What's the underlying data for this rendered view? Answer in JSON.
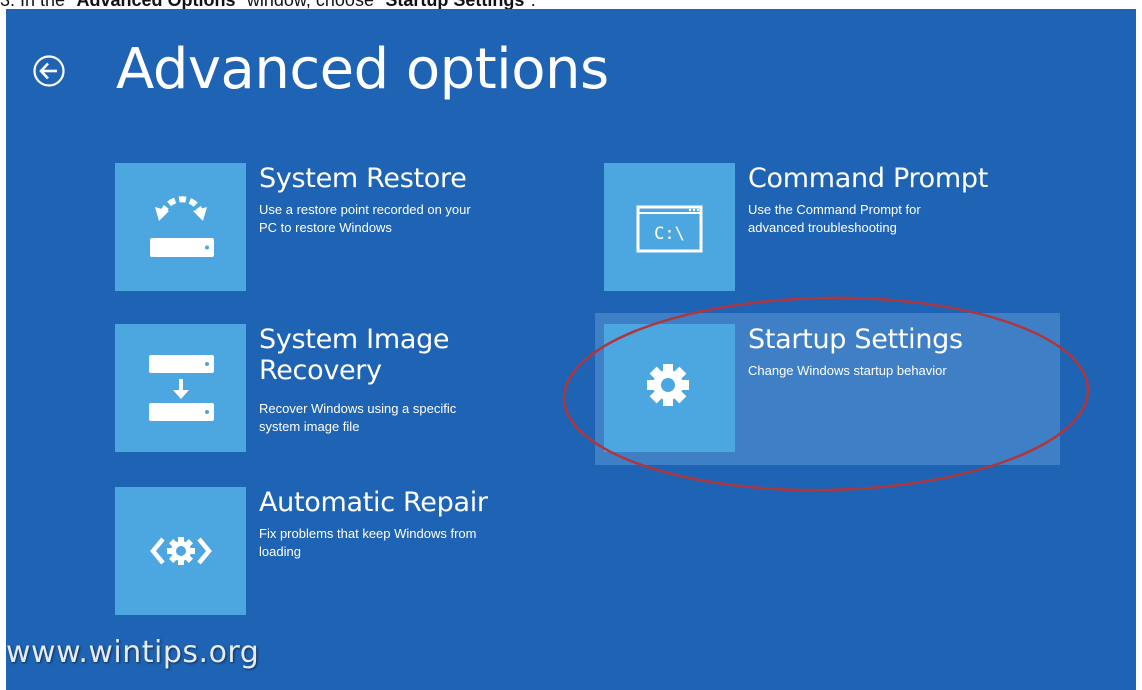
{
  "instruction": {
    "prefix": "3. In the \"",
    "window_name": "Advanced Options",
    "middle": "\" window, choose \"",
    "choice": "Startup Settings",
    "suffix": "\"."
  },
  "header": {
    "back_label": "Back",
    "title": "Advanced options"
  },
  "options": [
    {
      "name": "System Restore",
      "desc_lines": [
        "Use a restore point recorded on your",
        "PC to restore Windows"
      ],
      "icon": "system-restore-icon"
    },
    {
      "name_lines": [
        "System Image",
        "Recovery"
      ],
      "desc_lines": [
        "Recover Windows using a specific",
        "system image file"
      ],
      "icon": "system-image-recovery-icon"
    },
    {
      "name": "Automatic Repair",
      "desc_lines": [
        "Fix problems that keep Windows from",
        "loading"
      ],
      "icon": "automatic-repair-icon"
    },
    {
      "name": "Command Prompt",
      "desc_lines": [
        "Use the Command Prompt for",
        "advanced troubleshooting"
      ],
      "icon": "command-prompt-icon",
      "icon_text": "C:\\"
    },
    {
      "name": "Startup Settings",
      "desc_lines": [
        "Change Windows startup behavior"
      ],
      "icon": "gear-icon",
      "highlighted": true
    }
  ],
  "annotation": {
    "color": "#b0363e",
    "shape": "ellipse"
  },
  "watermark": "www.wintips.org",
  "colors": {
    "background": "#1f63b4",
    "tile": "#4ca6e0",
    "highlight": "#3f7fc6",
    "text": "#ffffff"
  }
}
